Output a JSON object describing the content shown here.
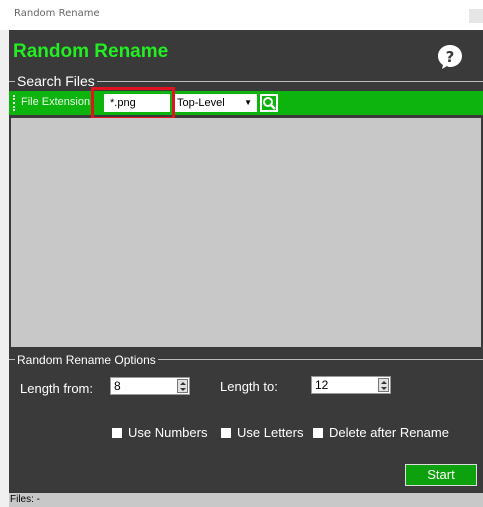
{
  "window": {
    "title": "Random Rename"
  },
  "header": {
    "title": "Random Rename",
    "help_icon": "question-bubble-icon"
  },
  "search": {
    "group_label": "Search Files",
    "extension_label": "File Extension:",
    "extension_value": "*.png",
    "scope_selected": "Top-Level",
    "search_icon": "search-icon"
  },
  "options": {
    "group_label": "Random Rename Options",
    "length_from_label": "Length from:",
    "length_from_value": "8",
    "length_to_label": "Length to:",
    "length_to_value": "12",
    "use_numbers": "Use Numbers",
    "use_letters": "Use Letters",
    "delete_after": "Delete after Rename",
    "start_label": "Start"
  },
  "status": {
    "text": "Files: -"
  },
  "colors": {
    "accent": "#0db40d",
    "title_green": "#22ee22",
    "highlight_red": "#e0141e",
    "background": "#3a3a3a"
  }
}
